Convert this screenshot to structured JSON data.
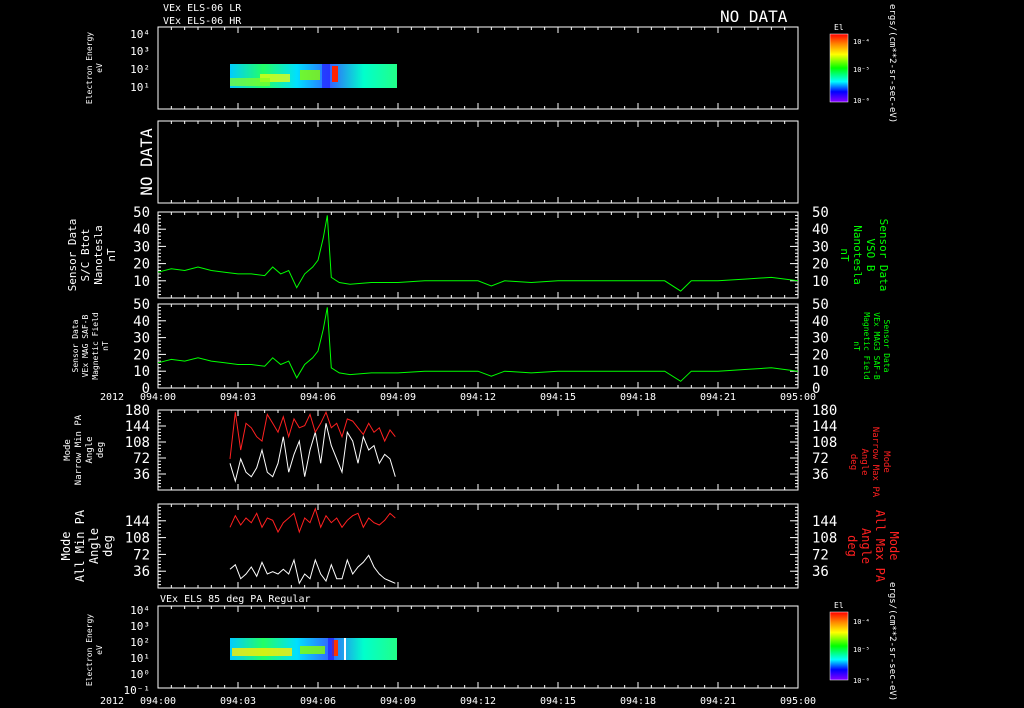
{
  "header": {
    "line1": "VEx ELS-06 LR",
    "line2": "VEx ELS-06 HR",
    "no_data": "NO DATA"
  },
  "colors": {
    "background": "#000000",
    "frame": "#ffffff",
    "green": "#00ff00",
    "red": "#ff2020",
    "white": "#ffffff"
  },
  "colorbars": {
    "label": "El",
    "units": "ergs/(cm**2-sr-sec-eV)",
    "ticks": [
      "10⁻⁴",
      "10⁻⁵",
      "10⁻⁶"
    ]
  },
  "time_axis": {
    "year": "2012",
    "ticks": [
      "094:00",
      "094:03",
      "094:06",
      "094:09",
      "094:12",
      "094:15",
      "094:18",
      "094:21",
      "095:00"
    ],
    "range_min": [
      0,
      24
    ]
  },
  "chart_data": [
    {
      "type": "heatmap",
      "title": "VEx ELS-06 LR / VEx ELS-06 HR",
      "ylabel": [
        "Electron Energy",
        "eV"
      ],
      "ytick_labels": [
        "10⁴",
        "10³",
        "10²",
        "10¹"
      ],
      "ylim_log10": [
        0,
        4.2
      ],
      "x_range_min": [
        2.9,
        9.0
      ],
      "y_range_log10": [
        0.8,
        2.3
      ]
    },
    {
      "type": "empty",
      "ylabel": [
        "NO DATA"
      ]
    },
    {
      "type": "line",
      "ylabel_left": [
        "Sensor Data",
        "S/C Btot",
        "Nanotesla",
        "nT"
      ],
      "ylabel_right": [
        "Sensor Data",
        "VSO B",
        "Nanotesla",
        "nT"
      ],
      "ylim": [
        0,
        50
      ],
      "yticks": [
        10,
        20,
        30,
        40,
        50
      ],
      "series": [
        {
          "x": [
            0,
            0.5,
            1,
            1.5,
            2,
            2.5,
            3,
            3.5,
            4,
            4.3,
            4.6,
            4.9,
            5.2,
            5.5,
            5.8,
            6.0,
            6.2,
            6.35,
            6.5,
            6.8,
            7.2,
            8,
            9,
            10,
            11,
            12,
            12.5,
            13,
            14,
            15,
            16,
            17,
            18,
            19,
            19.6,
            20,
            21,
            22,
            23,
            24
          ],
          "y": [
            15,
            17,
            16,
            18,
            16,
            15,
            14,
            14,
            13,
            18,
            14,
            16,
            6,
            14,
            18,
            22,
            35,
            48,
            12,
            9,
            8,
            9,
            9,
            10,
            10,
            10,
            7,
            10,
            9,
            10,
            10,
            10,
            10,
            10,
            4,
            10,
            10,
            11,
            12,
            10
          ]
        }
      ]
    },
    {
      "type": "line",
      "ylabel_left": [
        "Sensor Data",
        "VEx MAG SAF-B",
        "Magnetic Field",
        "nT"
      ],
      "ylabel_right": [
        "Sensor Data",
        "VEx MAG3 SAF-B",
        "Magnetic Field",
        "nT"
      ],
      "ylim": [
        0,
        50
      ],
      "yticks": [
        0,
        10,
        20,
        30,
        40,
        50
      ],
      "series": [
        {
          "x": [
            0,
            0.5,
            1,
            1.5,
            2,
            2.5,
            3,
            3.5,
            4,
            4.3,
            4.6,
            4.9,
            5.2,
            5.5,
            5.8,
            6.0,
            6.2,
            6.35,
            6.5,
            6.8,
            7.2,
            8,
            9,
            10,
            11,
            12,
            12.5,
            13,
            14,
            15,
            16,
            17,
            18,
            19,
            19.6,
            20,
            21,
            22,
            23,
            24
          ],
          "y": [
            15,
            17,
            16,
            18,
            16,
            15,
            14,
            14,
            13,
            18,
            14,
            16,
            6,
            14,
            18,
            22,
            35,
            48,
            12,
            9,
            8,
            9,
            9,
            10,
            10,
            10,
            7,
            10,
            9,
            10,
            10,
            10,
            10,
            10,
            4,
            10,
            10,
            11,
            12,
            10
          ]
        }
      ]
    },
    {
      "type": "line",
      "ylabel_left": [
        "Mode",
        "Narrow Min PA",
        "Angle",
        "deg"
      ],
      "ylabel_right": [
        "Mode",
        "Narrow Max PA",
        "Angle",
        "deg"
      ],
      "ylim": [
        0,
        180
      ],
      "yticks": [
        36,
        72,
        108,
        144,
        180
      ],
      "series": [
        {
          "color": "white",
          "x": [
            2.7,
            2.9,
            3.1,
            3.3,
            3.5,
            3.7,
            3.9,
            4.1,
            4.3,
            4.5,
            4.7,
            4.9,
            5.1,
            5.3,
            5.5,
            5.7,
            5.9,
            6.1,
            6.3,
            6.5,
            6.7,
            6.9,
            7.1,
            7.3,
            7.5,
            7.7,
            7.9,
            8.1,
            8.3,
            8.5,
            8.7,
            8.9
          ],
          "y": [
            60,
            20,
            70,
            40,
            30,
            50,
            90,
            40,
            30,
            60,
            120,
            40,
            80,
            110,
            30,
            90,
            130,
            60,
            150,
            100,
            70,
            40,
            130,
            110,
            60,
            120,
            90,
            100,
            60,
            80,
            70,
            30
          ]
        },
        {
          "color": "red",
          "x": [
            2.7,
            2.9,
            3.1,
            3.3,
            3.5,
            3.7,
            3.9,
            4.1,
            4.3,
            4.5,
            4.7,
            4.9,
            5.1,
            5.3,
            5.5,
            5.7,
            5.9,
            6.1,
            6.3,
            6.5,
            6.7,
            6.9,
            7.1,
            7.3,
            7.5,
            7.7,
            7.9,
            8.1,
            8.3,
            8.5,
            8.7,
            8.9
          ],
          "y": [
            70,
            175,
            90,
            150,
            140,
            120,
            110,
            170,
            150,
            130,
            165,
            120,
            160,
            140,
            145,
            170,
            130,
            150,
            175,
            140,
            150,
            120,
            160,
            155,
            140,
            125,
            150,
            130,
            140,
            110,
            135,
            120
          ]
        }
      ]
    },
    {
      "type": "line",
      "ylabel_left": [
        "Mode",
        "All Min PA",
        "Angle",
        "deg"
      ],
      "ylabel_right": [
        "Mode",
        "All Max PA",
        "Angle",
        "deg"
      ],
      "ylim": [
        0,
        180
      ],
      "yticks": [
        36,
        72,
        108,
        144
      ],
      "series": [
        {
          "color": "white",
          "x": [
            2.7,
            2.9,
            3.1,
            3.3,
            3.5,
            3.7,
            3.9,
            4.1,
            4.3,
            4.5,
            4.7,
            4.9,
            5.1,
            5.3,
            5.5,
            5.7,
            5.9,
            6.1,
            6.3,
            6.5,
            6.7,
            6.9,
            7.1,
            7.3,
            7.5,
            7.7,
            7.9,
            8.1,
            8.3,
            8.5,
            8.7,
            8.9
          ],
          "y": [
            40,
            50,
            20,
            30,
            45,
            25,
            55,
            30,
            35,
            30,
            40,
            30,
            60,
            10,
            30,
            20,
            60,
            30,
            15,
            50,
            20,
            20,
            60,
            30,
            45,
            55,
            70,
            45,
            30,
            20,
            15,
            10
          ]
        },
        {
          "color": "red",
          "x": [
            2.7,
            2.9,
            3.1,
            3.3,
            3.5,
            3.7,
            3.9,
            4.1,
            4.3,
            4.5,
            4.7,
            4.9,
            5.1,
            5.3,
            5.5,
            5.7,
            5.9,
            6.1,
            6.3,
            6.5,
            6.7,
            6.9,
            7.1,
            7.3,
            7.5,
            7.7,
            7.9,
            8.1,
            8.3,
            8.5,
            8.7,
            8.9
          ],
          "y": [
            130,
            155,
            135,
            150,
            140,
            160,
            130,
            150,
            145,
            120,
            140,
            150,
            160,
            120,
            150,
            140,
            170,
            130,
            155,
            140,
            150,
            130,
            145,
            155,
            160,
            130,
            150,
            140,
            135,
            145,
            160,
            150
          ]
        }
      ]
    },
    {
      "type": "heatmap",
      "title": "VEx ELS 85 deg PA Regular",
      "ylabel": [
        "Electron Energy",
        "eV"
      ],
      "ytick_labels": [
        "10⁴",
        "10³",
        "10²",
        "10¹",
        "10⁰",
        "10⁻¹"
      ],
      "ylim_log10": [
        -1,
        4.2
      ],
      "x_range_min": [
        2.9,
        9.0
      ],
      "y_range_log10": [
        0.8,
        2.1
      ]
    }
  ]
}
